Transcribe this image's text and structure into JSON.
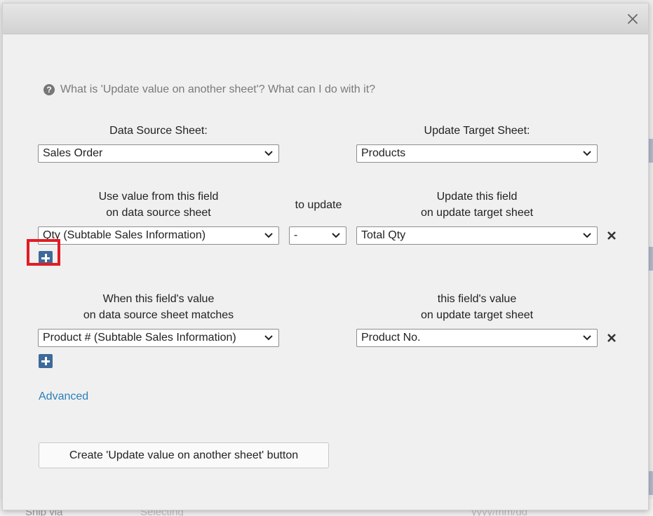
{
  "background": {
    "ship_via_label": "Ship via",
    "select_placeholder": "Selecting",
    "date_placeholder": "yyyy/mm/dd"
  },
  "dialog": {
    "close_icon": "close-icon",
    "help_text": "What is 'Update value on another sheet'? What can I do with it?",
    "data_source_label": "Data Source Sheet:",
    "data_source_value": "Sales Order",
    "target_sheet_label": "Update Target Sheet:",
    "target_sheet_value": "Products",
    "use_value_label": "Use value from this field\non data source sheet",
    "to_update_label": "to update",
    "update_field_label": "Update this field\non update target sheet",
    "source_field_value": "Qty (Subtable Sales Information)",
    "operator_value": "-",
    "target_field_value": "Total Qty",
    "match_label": "When this field's value\non data source sheet matches",
    "match_target_label": "this field's value\non update target sheet",
    "match_source_value": "Product # (Subtable Sales Information)",
    "match_target_value": "Product No.",
    "advanced_link": "Advanced",
    "create_button": "Create 'Update value on another sheet' button"
  },
  "colors": {
    "accent_blue": "#3d6a9a",
    "link_blue": "#2b7fb8",
    "highlight_red": "#e31b23"
  }
}
